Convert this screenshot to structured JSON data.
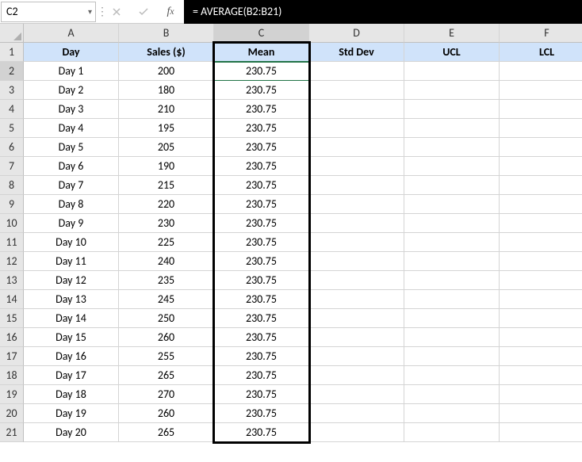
{
  "formula_bar": {
    "cell_ref": "C2",
    "formula": "= AVERAGE(B2:B21)"
  },
  "columns": [
    "A",
    "B",
    "C",
    "D",
    "E",
    "F"
  ],
  "row_numbers": [
    1,
    2,
    3,
    4,
    5,
    6,
    7,
    8,
    9,
    10,
    11,
    12,
    13,
    14,
    15,
    16,
    17,
    18,
    19,
    20,
    21
  ],
  "headers": {
    "A": "Day",
    "B": "Sales ($)",
    "C": "Mean",
    "D": "Std Dev",
    "E": "UCL",
    "F": "LCL"
  },
  "rows": [
    {
      "A": "Day 1",
      "B": "200",
      "C": "230.75",
      "D": "",
      "E": "",
      "F": ""
    },
    {
      "A": "Day 2",
      "B": "180",
      "C": "230.75",
      "D": "",
      "E": "",
      "F": ""
    },
    {
      "A": "Day 3",
      "B": "210",
      "C": "230.75",
      "D": "",
      "E": "",
      "F": ""
    },
    {
      "A": "Day 4",
      "B": "195",
      "C": "230.75",
      "D": "",
      "E": "",
      "F": ""
    },
    {
      "A": "Day 5",
      "B": "205",
      "C": "230.75",
      "D": "",
      "E": "",
      "F": ""
    },
    {
      "A": "Day 6",
      "B": "190",
      "C": "230.75",
      "D": "",
      "E": "",
      "F": ""
    },
    {
      "A": "Day 7",
      "B": "215",
      "C": "230.75",
      "D": "",
      "E": "",
      "F": ""
    },
    {
      "A": "Day 8",
      "B": "220",
      "C": "230.75",
      "D": "",
      "E": "",
      "F": ""
    },
    {
      "A": "Day 9",
      "B": "230",
      "C": "230.75",
      "D": "",
      "E": "",
      "F": ""
    },
    {
      "A": "Day 10",
      "B": "225",
      "C": "230.75",
      "D": "",
      "E": "",
      "F": ""
    },
    {
      "A": "Day 11",
      "B": "240",
      "C": "230.75",
      "D": "",
      "E": "",
      "F": ""
    },
    {
      "A": "Day 12",
      "B": "235",
      "C": "230.75",
      "D": "",
      "E": "",
      "F": ""
    },
    {
      "A": "Day 13",
      "B": "245",
      "C": "230.75",
      "D": "",
      "E": "",
      "F": ""
    },
    {
      "A": "Day 14",
      "B": "250",
      "C": "230.75",
      "D": "",
      "E": "",
      "F": ""
    },
    {
      "A": "Day 15",
      "B": "260",
      "C": "230.75",
      "D": "",
      "E": "",
      "F": ""
    },
    {
      "A": "Day 16",
      "B": "255",
      "C": "230.75",
      "D": "",
      "E": "",
      "F": ""
    },
    {
      "A": "Day 17",
      "B": "265",
      "C": "230.75",
      "D": "",
      "E": "",
      "F": ""
    },
    {
      "A": "Day 18",
      "B": "270",
      "C": "230.75",
      "D": "",
      "E": "",
      "F": ""
    },
    {
      "A": "Day 19",
      "B": "260",
      "C": "230.75",
      "D": "",
      "E": "",
      "F": ""
    },
    {
      "A": "Day 20",
      "B": "265",
      "C": "230.75",
      "D": "",
      "E": "",
      "F": ""
    }
  ],
  "active_cell": {
    "row": 2,
    "col": "C"
  },
  "highlight": {
    "col": "C",
    "row_start": 1,
    "row_end": 21
  }
}
